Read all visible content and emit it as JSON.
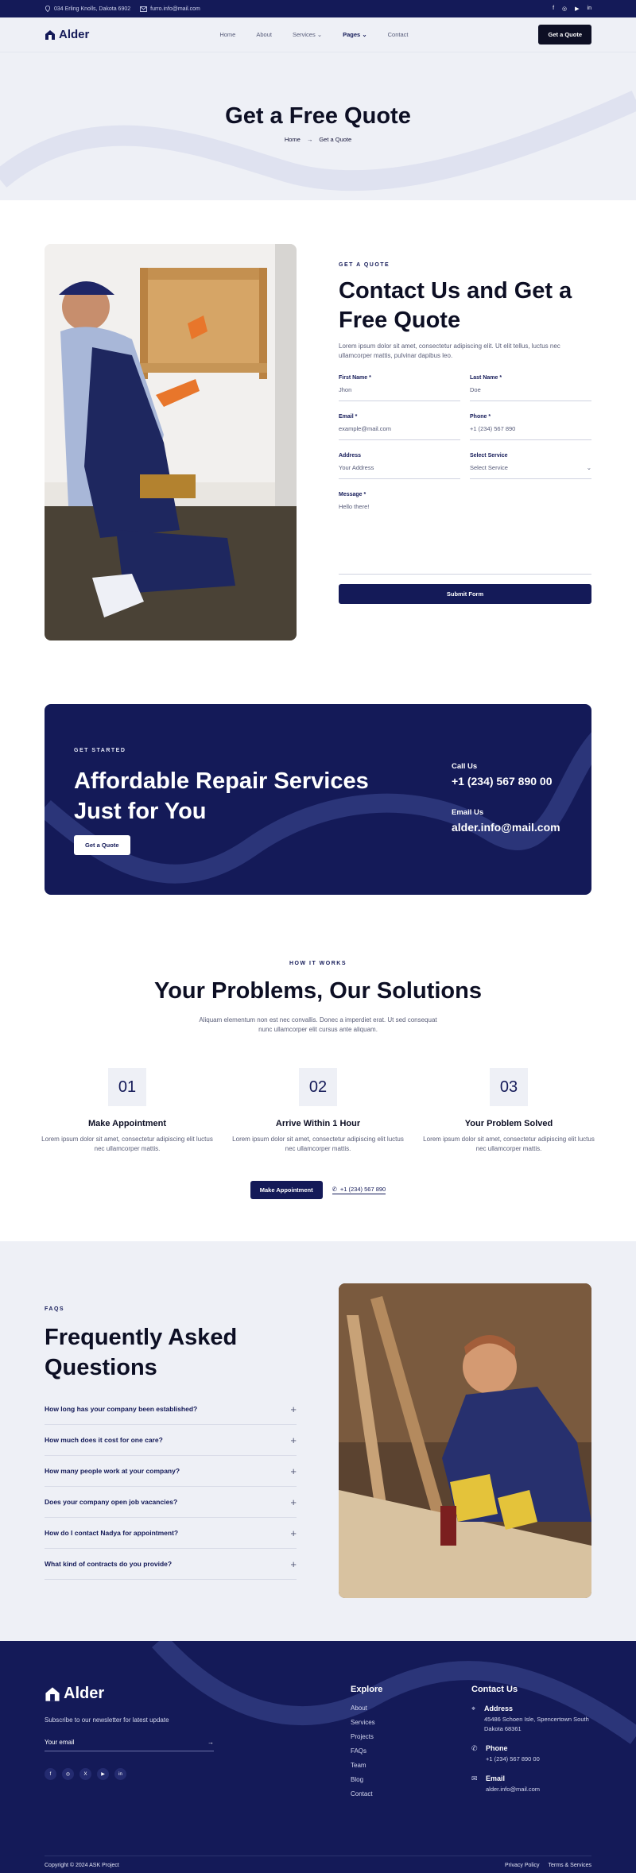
{
  "topbar": {
    "address": "034 Erling Knolls, Dakota 6902",
    "email": "furro.info@mail.com",
    "social": [
      "f",
      "◎",
      "▶",
      "in"
    ]
  },
  "nav": {
    "brand": "Alder",
    "links": [
      "Home",
      "About",
      "Services",
      "Pages",
      "Contact"
    ],
    "active": "Pages",
    "cta": "Get a Quote"
  },
  "hero": {
    "title": "Get a Free Quote",
    "breadcrumb_home": "Home",
    "breadcrumb_current": "Get a Quote"
  },
  "quote": {
    "eyebrow": "GET A QUOTE",
    "title": "Contact Us and Get a Free Quote",
    "lead": "Lorem ipsum dolor sit amet, consectetur adipiscing elit. Ut elit tellus, luctus nec ullamcorper mattis, pulvinar dapibus leo.",
    "fields": {
      "first_name_label": "First Name *",
      "first_name_value": "Jhon",
      "last_name_label": "Last Name *",
      "last_name_value": "Doe",
      "email_label": "Email *",
      "email_placeholder": "example@mail.com",
      "phone_label": "Phone *",
      "phone_placeholder": "+1 (234) 567 890",
      "address_label": "Address",
      "address_placeholder": "Your Address",
      "service_label": "Select Service",
      "service_value": "Select Service",
      "message_label": "Message *",
      "message_placeholder": "Hello there!"
    },
    "submit": "Submit Form"
  },
  "cta": {
    "eyebrow": "GET STARTED",
    "title": "Affordable Repair Services Just for You",
    "button": "Get a Quote",
    "call_label": "Call Us",
    "call_value": "+1 (234) 567 890 00",
    "email_label": "Email Us",
    "email_value": "alder.info@mail.com"
  },
  "how": {
    "eyebrow": "HOW IT WORKS",
    "title": "Your Problems, Our Solutions",
    "lead": "Aliquam elementum non est nec convallis. Donec a imperdiet erat. Ut sed consequat nunc ullamcorper elit cursus ante aliquam.",
    "steps": [
      {
        "num": "01",
        "title": "Make Appointment",
        "text": "Lorem ipsum dolor sit amet, consectetur adipiscing elit luctus nec ullamcorper mattis."
      },
      {
        "num": "02",
        "title": "Arrive Within 1 Hour",
        "text": "Lorem ipsum dolor sit amet, consectetur adipiscing elit luctus nec ullamcorper mattis."
      },
      {
        "num": "03",
        "title": "Your Problem Solved",
        "text": "Lorem ipsum dolor sit amet, consectetur adipiscing elit luctus nec ullamcorper mattis."
      }
    ],
    "button": "Make Appointment",
    "phone": "+1 (234) 567 890"
  },
  "faq": {
    "eyebrow": "FAQS",
    "title": "Frequently Asked Questions",
    "items": [
      "How long has your company been established?",
      "How much does it cost for one care?",
      "How many people work at your company?",
      "Does your company open job vacancies?",
      "How do I contact Nadya for appointment?",
      "What kind of contracts do you provide?"
    ]
  },
  "footer": {
    "brand": "Alder",
    "subscribe": "Subscribe to our newsletter for latest update",
    "email_placeholder": "Your email",
    "social": [
      "f",
      "◎",
      "X",
      "▶",
      "in"
    ],
    "explore_title": "Explore",
    "explore": [
      "About",
      "Services",
      "Projects",
      "FAQs",
      "Team",
      "Blog",
      "Contact"
    ],
    "contact_title": "Contact Us",
    "address_title": "Address",
    "address_value": "45486 Schoen Isle, Spencertown South Dakota 68361",
    "phone_title": "Phone",
    "phone_value": "+1 (234) 567 890 00",
    "email_title": "Email",
    "email_value": "alder.info@mail.com",
    "copyright": "Copyright © 2024 ASK Project",
    "privacy": "Privacy Policy",
    "terms": "Terms & Services"
  },
  "colors": {
    "navy": "#141a58",
    "light": "#eef0f6",
    "dark": "#0d0f24"
  }
}
